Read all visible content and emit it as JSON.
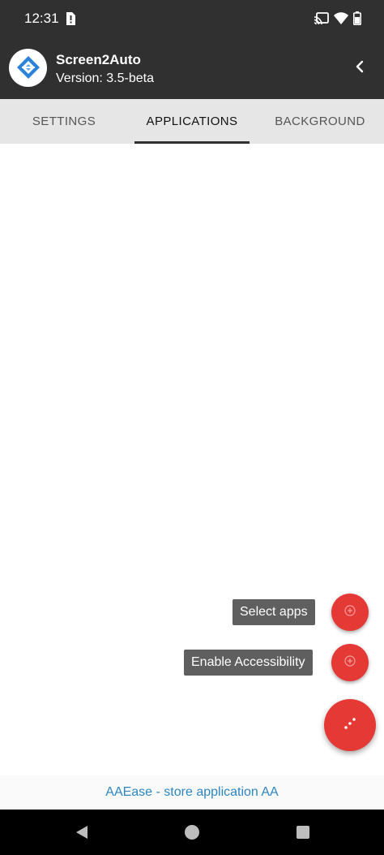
{
  "status_bar": {
    "time": "12:31",
    "icons": [
      "sim-alert-icon",
      "cast-icon",
      "wifi-icon",
      "battery-icon"
    ]
  },
  "app_bar": {
    "title": "Screen2Auto",
    "version": "Version: 3.5-beta",
    "back_icon": "chevron-left-icon"
  },
  "tabs": [
    {
      "label": "SETTINGS",
      "active": false
    },
    {
      "label": "APPLICATIONS",
      "active": true
    },
    {
      "label": "BACKGROUND",
      "active": false
    }
  ],
  "fab_menu": {
    "select_apps_label": "Select apps",
    "enable_accessibility_label": "Enable Accessibility",
    "main_fab_icon": "dots-icon",
    "mini_fab_icon": "add-circle-icon"
  },
  "footer": {
    "link_text": "AAEase - store application AA"
  },
  "colors": {
    "appbar": "#303030",
    "fab": "#e53935",
    "link": "#2e86c1",
    "tabs_bg": "#e6e6e6"
  }
}
